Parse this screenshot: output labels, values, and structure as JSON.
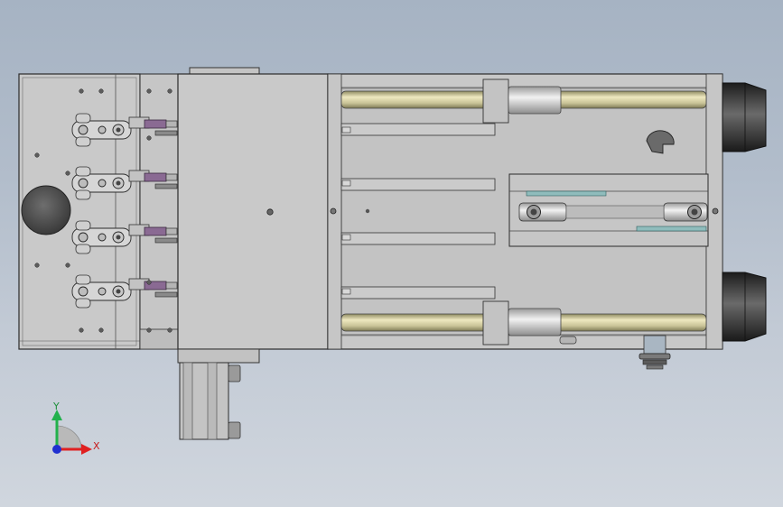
{
  "view": {
    "background_top": "#a6b3c3",
    "background_bottom": "#d0d6de"
  },
  "model": {
    "body_color": "#c8c8c8",
    "edge_color": "#2a2a2a",
    "rod_color": "#cdc79a",
    "clamp_handle_color": "#8a6a93",
    "nozzle_color": "#3c3c3c",
    "clamp_count": 4
  },
  "triad": {
    "y_label": "Y",
    "x_label": "X",
    "y_color": "#22b14c",
    "x_color": "#e02020",
    "z_color": "#2030d0"
  }
}
